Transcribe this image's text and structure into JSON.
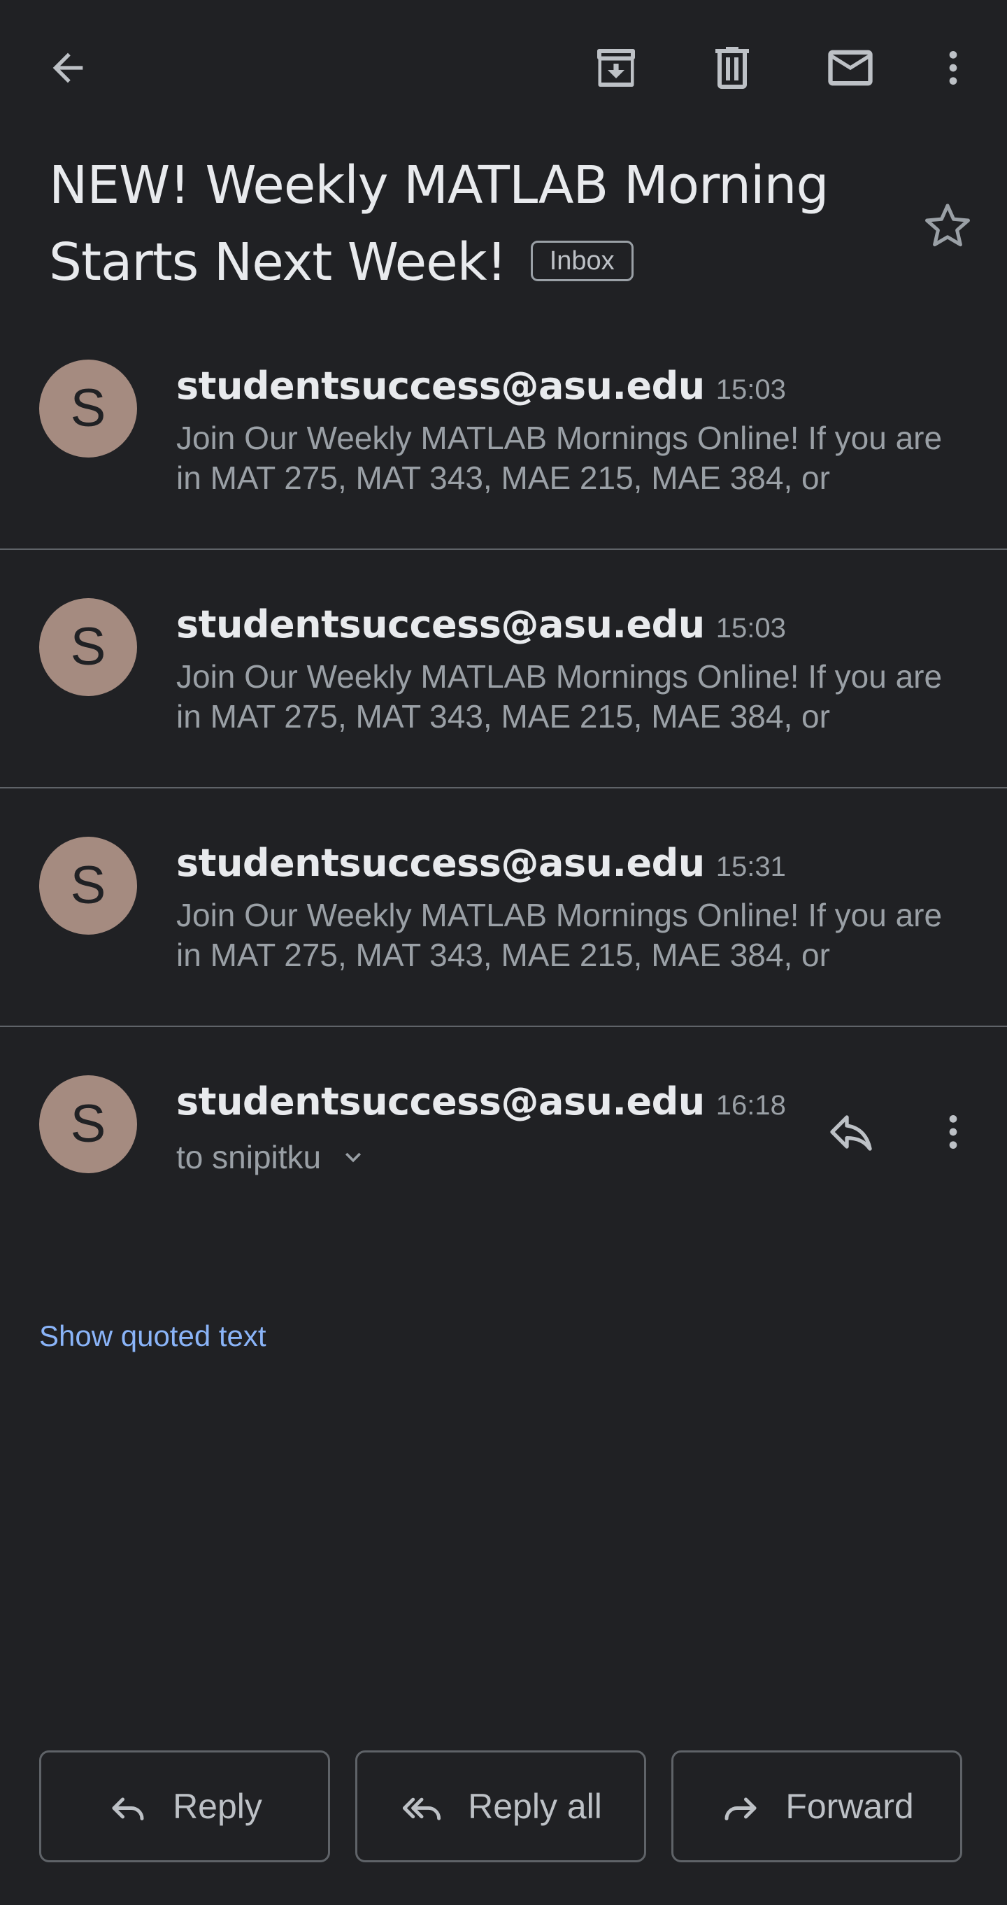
{
  "toolbar": {
    "back_icon": "arrow-back-icon",
    "archive_icon": "archive-icon",
    "delete_icon": "delete-icon",
    "mark_unread_icon": "mail-icon",
    "more_icon": "more-vert-icon"
  },
  "subject": {
    "text": "NEW! Weekly MATLAB Morning Starts Next Week!",
    "label_chip": "Inbox"
  },
  "messages": [
    {
      "avatar_letter": "S",
      "sender": "studentsuccess@asu.edu",
      "time": "15:03",
      "snippet": "Join Our Weekly MATLAB Mornings Online! If you are in MAT 275, MAT 343, MAE 215, MAE 384, or"
    },
    {
      "avatar_letter": "S",
      "sender": "studentsuccess@asu.edu",
      "time": "15:03",
      "snippet": "Join Our Weekly MATLAB Mornings Online! If you are in MAT 275, MAT 343, MAE 215, MAE 384, or"
    },
    {
      "avatar_letter": "S",
      "sender": "studentsuccess@asu.edu",
      "time": "15:31",
      "snippet": "Join Our Weekly MATLAB Mornings Online! If you are in MAT 275, MAT 343, MAE 215, MAE 384, or"
    }
  ],
  "expanded_message": {
    "avatar_letter": "S",
    "sender": "studentsuccess@asu.edu",
    "time": "16:18",
    "recipient": "to snipitku",
    "show_quoted": "Show quoted text"
  },
  "actions": {
    "reply": "Reply",
    "reply_all": "Reply all",
    "forward": "Forward"
  },
  "colors": {
    "background": "#202124",
    "avatar": "#a58b80",
    "link": "#8ab4f8",
    "secondary_text": "#9aa0a6"
  }
}
